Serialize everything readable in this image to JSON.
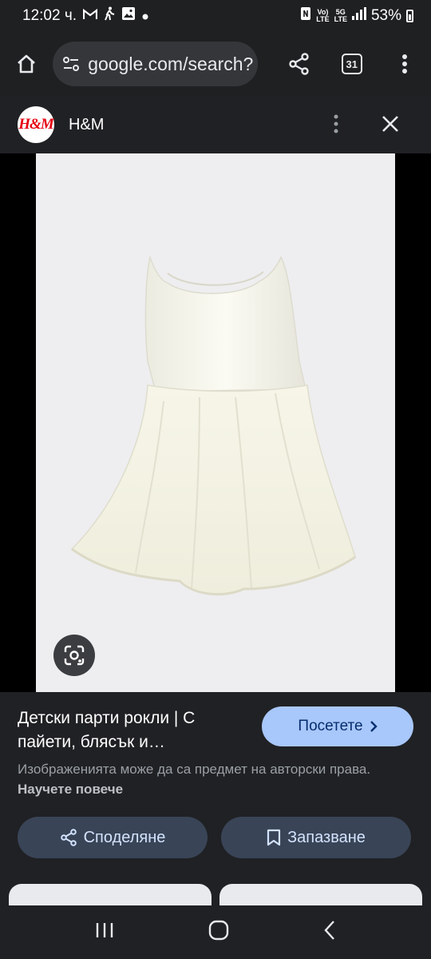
{
  "status_bar": {
    "time": "12:02 ч.",
    "signal_top": "5G",
    "signal_bottom": "LTE",
    "vo_top": "Vo)",
    "vo_bottom": "LTE",
    "battery": "53%"
  },
  "browser": {
    "url": "google.com/search?",
    "tab_count": "31"
  },
  "source": {
    "logo_text": "H&M",
    "name": "H&M"
  },
  "result": {
    "title": "Детски парти рокли | С пайети, блясък и…",
    "visit_label": "Посетете",
    "copyright_text": "Изображенията може да са предмет на авторски права.",
    "learn_more": "Научете повече",
    "share_label": "Споделяне",
    "save_label": "Запазване"
  },
  "colors": {
    "accent": "#a8c7fa",
    "button_bg": "#394457",
    "panel_bg": "#202124"
  }
}
